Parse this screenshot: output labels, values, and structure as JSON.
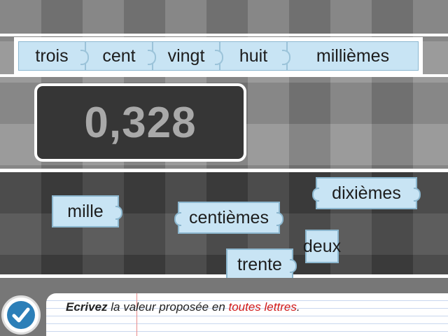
{
  "answer_slots": [
    {
      "label": "trois"
    },
    {
      "label": "cent"
    },
    {
      "label": "vingt"
    },
    {
      "label": "huit"
    },
    {
      "label": "millièmes"
    }
  ],
  "number_display": "0,328",
  "tiles": [
    {
      "label": "mille"
    },
    {
      "label": "centièmes"
    },
    {
      "label": "dixièmes"
    },
    {
      "label": "deux"
    },
    {
      "label": "trente"
    }
  ],
  "instruction": {
    "verb": "Ecrivez",
    "middle": " la valeur proposée en ",
    "highlight": "toutes lettres",
    "end": "."
  },
  "colors": {
    "tile_fill": "#c8e4f4",
    "tile_border": "#8cb7cf",
    "check_button": "#2c7fb8",
    "highlight_text": "#d11a1a"
  },
  "icons": {
    "validate": "checkmark-icon"
  }
}
